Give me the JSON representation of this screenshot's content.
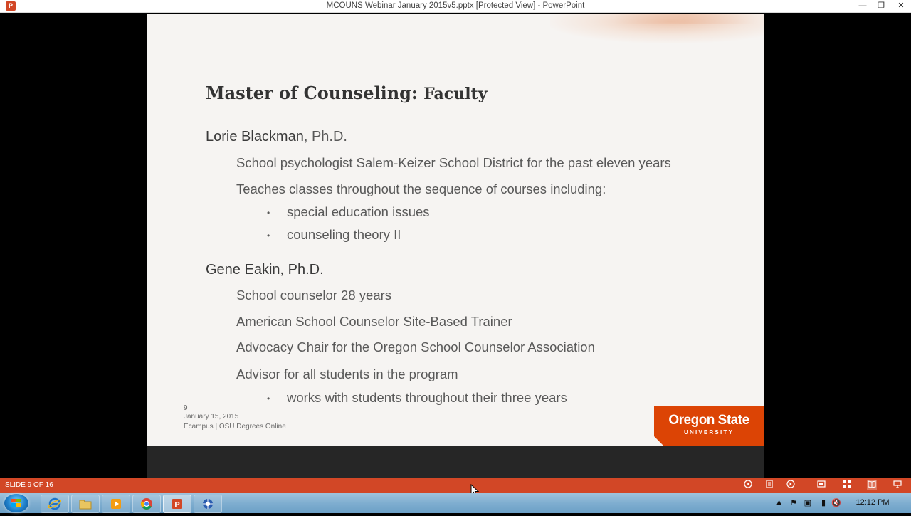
{
  "window": {
    "title": "MCOUNS Webinar January 2015v5.pptx [Protected View] - PowerPoint",
    "app_icon_letter": "P",
    "minimize": "—",
    "restore": "❐",
    "close": "✕"
  },
  "slide": {
    "title_main": "Master of Counseling: ",
    "title_sub": "Faculty",
    "faculty": [
      {
        "name": "Lorie Blackman",
        "credential": ", Ph.D.",
        "lines": [
          "School psychologist Salem-Keizer School District for the past eleven years",
          "Teaches classes throughout the sequence of courses including:"
        ],
        "bullets": [
          "special education issues",
          "counseling theory II"
        ]
      },
      {
        "name": "Gene Eakin, Ph.D.",
        "lines": [
          "School counselor 28 years",
          "American School Counselor Site-Based Trainer",
          "Advocacy Chair for the Oregon School Counselor Association",
          "Advisor for all students in the program"
        ],
        "bullets": [
          "works with students throughout their three years"
        ]
      }
    ],
    "footer": {
      "slide_number": "9",
      "date": "January 15, 2015",
      "org": "Ecampus | OSU Degrees Online"
    },
    "logo": {
      "line1": "Oregon State",
      "line2": "UNIVERSITY",
      "color": "#dc4405"
    },
    "bullet_char": "•"
  },
  "statusbar": {
    "slide_count": "SLIDE 9 OF 16",
    "color": "#d24726",
    "icons": [
      "previous-icon",
      "notes-icon",
      "next-icon",
      "normal-view-icon",
      "slide-sorter-icon",
      "reading-view-icon",
      "slideshow-icon"
    ]
  },
  "taskbar": {
    "apps": [
      "internet-explorer-icon",
      "file-explorer-icon",
      "media-player-icon",
      "chrome-icon",
      "powerpoint-icon",
      "network-app-icon"
    ],
    "clock": "12:12 PM",
    "tray_icons": [
      "show-hidden-icons",
      "action-center-flag-icon",
      "devices-icon",
      "network-icon",
      "volume-muted-icon"
    ]
  }
}
